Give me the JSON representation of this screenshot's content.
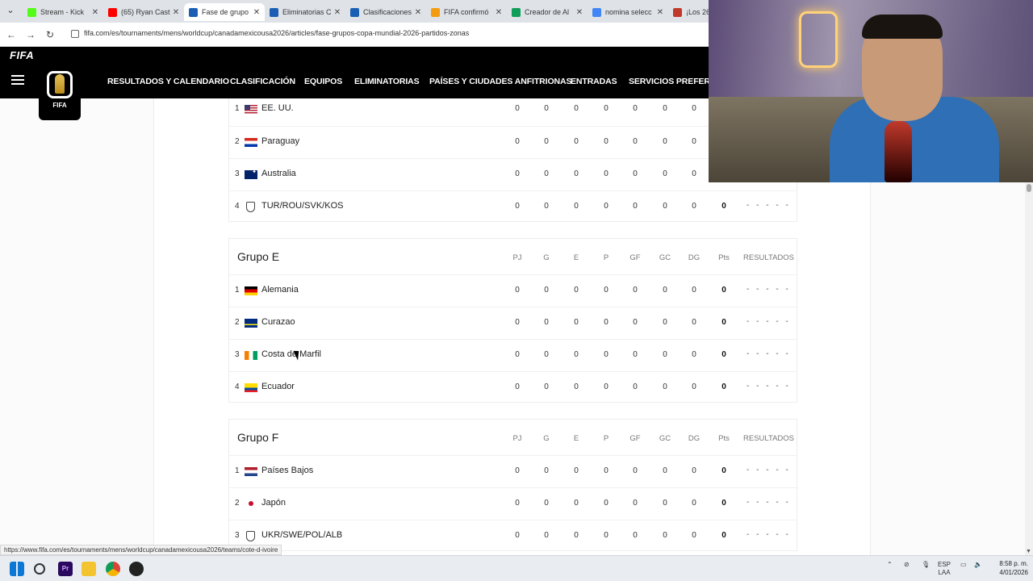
{
  "browser": {
    "tabs": [
      {
        "title": "Stream - Kick",
        "favicon_color": "#53fc18",
        "active": false
      },
      {
        "title": "(65) Ryan Cast",
        "favicon_color": "#ff0000",
        "active": false
      },
      {
        "title": "Fase de grupo",
        "favicon_color": "#1a5fb4",
        "active": true
      },
      {
        "title": "Eliminatorias C",
        "favicon_color": "#1a5fb4",
        "active": false
      },
      {
        "title": "Clasificaciones",
        "favicon_color": "#1a5fb4",
        "active": false
      },
      {
        "title": "FIFA confirmó",
        "favicon_color": "#f39c12",
        "active": false
      },
      {
        "title": "Creador de Al",
        "favicon_color": "#0f9d58",
        "active": false
      },
      {
        "title": "nomina selecc",
        "favicon_color": "#4285f4",
        "active": false
      },
      {
        "title": "¡Los 26",
        "favicon_color": "#c0392b",
        "active": false
      }
    ],
    "url": "fifa.com/es/tournaments/mens/worldcup/canadamexicousa2026/articles/fase-grupos-copa-mundial-2026-partidos-zonas",
    "status_url": "https://www.fifa.com/es/tournaments/mens/worldcup/canadamexicousa2026/teams/cote-d-ivoire"
  },
  "header": {
    "brand": "FIFA",
    "logo_text": "FIFA",
    "nav": [
      "RESULTADOS Y CALENDARIO",
      "CLASIFICACIÓN",
      "EQUIPOS",
      "ELIMINATORIAS",
      "PAÍSES Y CIUDADES ANFITRIONAS",
      "ENTRADAS",
      "SERVICIOS PREFEREN"
    ]
  },
  "columns": {
    "pj": "PJ",
    "g": "G",
    "e": "E",
    "p": "P",
    "gf": "GF",
    "gc": "GC",
    "dg": "DG",
    "pts": "Pts",
    "results": "RESULTADOS"
  },
  "groups": [
    {
      "title": "",
      "rows": [
        {
          "pos": "1",
          "team": "EE. UU.",
          "flag": "us",
          "stats": [
            "0",
            "0",
            "0",
            "0",
            "0",
            "0",
            "0"
          ],
          "pts": "",
          "results": ""
        },
        {
          "pos": "2",
          "team": "Paraguay",
          "flag": "py",
          "stats": [
            "0",
            "0",
            "0",
            "0",
            "0",
            "0",
            "0"
          ],
          "pts": "",
          "results": ""
        },
        {
          "pos": "3",
          "team": "Australia",
          "flag": "au",
          "stats": [
            "0",
            "0",
            "0",
            "0",
            "0",
            "0",
            "0"
          ],
          "pts": "",
          "results": ""
        },
        {
          "pos": "4",
          "team": "TUR/ROU/SVK/KOS",
          "flag": "shield",
          "stats": [
            "0",
            "0",
            "0",
            "0",
            "0",
            "0",
            "0"
          ],
          "pts": "0",
          "results": "- - - - -"
        }
      ]
    },
    {
      "title": "Grupo E",
      "rows": [
        {
          "pos": "1",
          "team": "Alemania",
          "flag": "de",
          "stats": [
            "0",
            "0",
            "0",
            "0",
            "0",
            "0",
            "0"
          ],
          "pts": "0",
          "results": "- - - - -"
        },
        {
          "pos": "2",
          "team": "Curazao",
          "flag": "cw",
          "stats": [
            "0",
            "0",
            "0",
            "0",
            "0",
            "0",
            "0"
          ],
          "pts": "0",
          "results": "- - - - -"
        },
        {
          "pos": "3",
          "team": "Costa de Marfil",
          "flag": "ci",
          "stats": [
            "0",
            "0",
            "0",
            "0",
            "0",
            "0",
            "0"
          ],
          "pts": "0",
          "results": "- - - - -"
        },
        {
          "pos": "4",
          "team": "Ecuador",
          "flag": "ec",
          "stats": [
            "0",
            "0",
            "0",
            "0",
            "0",
            "0",
            "0"
          ],
          "pts": "0",
          "results": "- - - - -"
        }
      ]
    },
    {
      "title": "Grupo F",
      "rows": [
        {
          "pos": "1",
          "team": "Países Bajos",
          "flag": "nl",
          "stats": [
            "0",
            "0",
            "0",
            "0",
            "0",
            "0",
            "0"
          ],
          "pts": "0",
          "results": "- - - - -"
        },
        {
          "pos": "2",
          "team": "Japón",
          "flag": "jp",
          "stats": [
            "0",
            "0",
            "0",
            "0",
            "0",
            "0",
            "0"
          ],
          "pts": "0",
          "results": "- - - - -"
        },
        {
          "pos": "3",
          "team": "UKR/SWE/POL/ALB",
          "flag": "shield",
          "stats": [
            "0",
            "0",
            "0",
            "0",
            "0",
            "0",
            "0"
          ],
          "pts": "0",
          "results": "- - - - -"
        }
      ]
    }
  ],
  "taskbar": {
    "lang_top": "ESP",
    "lang_bottom": "LAA",
    "time": "8:58 p. m.",
    "date": "4/01/2026"
  }
}
